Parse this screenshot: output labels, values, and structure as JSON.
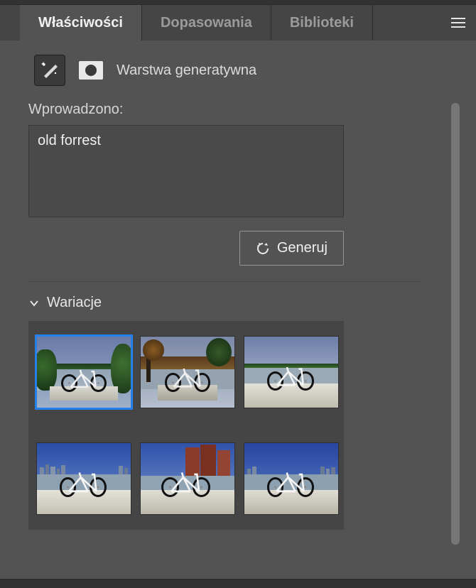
{
  "tabs": {
    "properties": "Właściwości",
    "adjustments": "Dopasowania",
    "libraries": "Biblioteki"
  },
  "layer": {
    "title": "Warstwa generatywna"
  },
  "prompt": {
    "label": "Wprowadzono:",
    "value": "old forrest"
  },
  "buttons": {
    "generate": "Generuj"
  },
  "sections": {
    "variations": "Wariacje"
  },
  "variations": {
    "selected_index": 0,
    "items": [
      {
        "id": 0,
        "env": "forest-lake",
        "selected": true
      },
      {
        "id": 1,
        "env": "autumn-pond",
        "selected": false
      },
      {
        "id": 2,
        "env": "open-lake",
        "selected": false
      },
      {
        "id": 3,
        "env": "city-skyline",
        "selected": false
      },
      {
        "id": 4,
        "env": "brick-towers",
        "selected": false
      },
      {
        "id": 5,
        "env": "harbor-city",
        "selected": false
      }
    ]
  }
}
